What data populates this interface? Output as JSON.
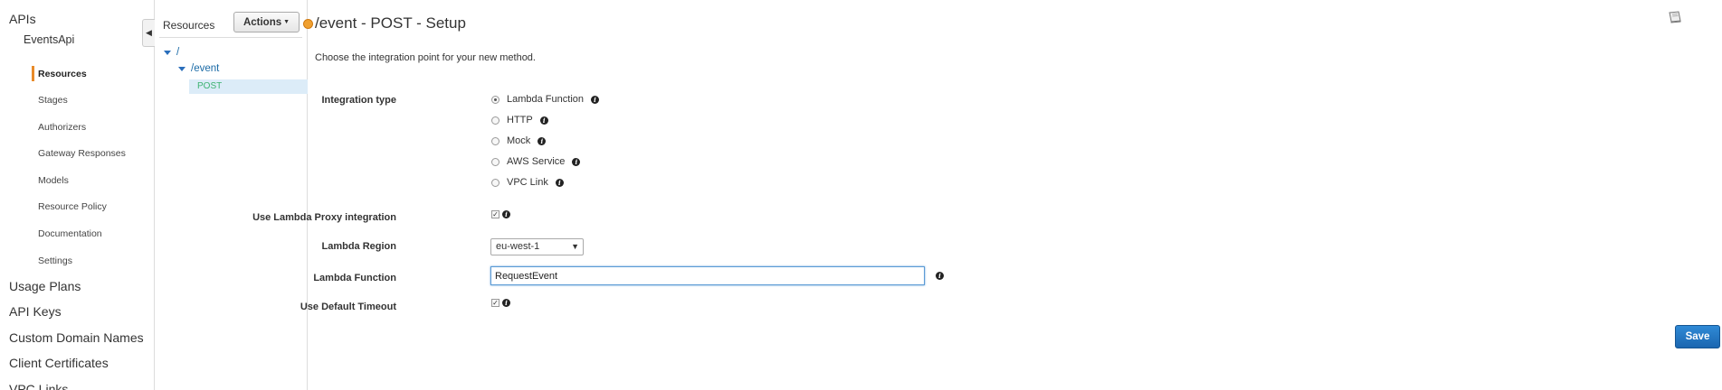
{
  "nav": {
    "apis": "APIs",
    "api_name": "EventsApi",
    "sub_items": [
      "Resources",
      "Stages",
      "Authorizers",
      "Gateway Responses",
      "Models",
      "Resource Policy",
      "Documentation",
      "Settings"
    ],
    "bottom_items": [
      "Usage Plans",
      "API Keys",
      "Custom Domain Names",
      "Client Certificates",
      "VPC Links"
    ]
  },
  "resources": {
    "title": "Resources",
    "actions_label": "Actions",
    "tree": [
      {
        "path": "/"
      },
      {
        "path": "/event"
      }
    ],
    "selected_method": "POST"
  },
  "main": {
    "title": "/event - POST - Setup",
    "intro": "Choose the integration point for your new method.",
    "integration_type_label": "Integration type",
    "integration_options": [
      "Lambda Function",
      "HTTP",
      "Mock",
      "AWS Service",
      "VPC Link"
    ],
    "selected_integration": "Lambda Function",
    "proxy_label": "Use Lambda Proxy integration",
    "proxy_checked": true,
    "region_label": "Lambda Region",
    "region_value": "eu-west-1",
    "function_label": "Lambda Function",
    "function_value": "RequestEvent",
    "timeout_label": "Use Default Timeout",
    "timeout_checked": true,
    "save_label": "Save"
  },
  "colors": {
    "accent": "#e88b2a",
    "link": "#1a6aa6",
    "method": "#3cb371",
    "save": "#1f6fba"
  }
}
